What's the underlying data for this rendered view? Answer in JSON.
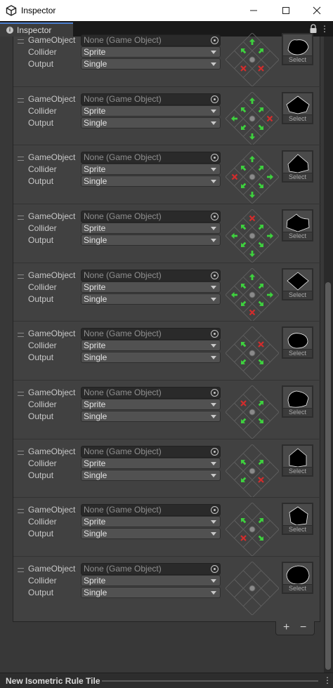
{
  "window": {
    "title": "Inspector",
    "minimize_label": "—",
    "maximize_label": "☐",
    "close_label": "✕"
  },
  "tab": {
    "label": "Inspector",
    "info_icon": "i"
  },
  "labels": {
    "gameobject": "GameObject",
    "collider": "Collider",
    "output": "Output"
  },
  "colors": {
    "arrow": "#3ed13e",
    "blocked": "#d22c2c",
    "panel": "#414141",
    "accent": "#4c7fd0"
  },
  "rules": [
    {
      "gameobject_value": "None (Game Object)",
      "collider": "Sprite",
      "output": "Single",
      "select_label": "Select",
      "neighbors": {
        "n": "arrow",
        "ne": "arrow",
        "e": "none",
        "se": "x",
        "s": "none",
        "sw": "x",
        "w": "none",
        "nw": "arrow"
      }
    },
    {
      "gameobject_value": "None (Game Object)",
      "collider": "Sprite",
      "output": "Single",
      "select_label": "Select",
      "neighbors": {
        "n": "arrow",
        "ne": "arrow",
        "e": "x",
        "se": "arrow",
        "s": "arrow",
        "sw": "arrow",
        "w": "arrow",
        "nw": "arrow"
      }
    },
    {
      "gameobject_value": "None (Game Object)",
      "collider": "Sprite",
      "output": "Single",
      "select_label": "Select",
      "neighbors": {
        "n": "arrow",
        "ne": "arrow",
        "e": "arrow",
        "se": "arrow",
        "s": "arrow",
        "sw": "arrow",
        "w": "x",
        "nw": "arrow"
      }
    },
    {
      "gameobject_value": "None (Game Object)",
      "collider": "Sprite",
      "output": "Single",
      "select_label": "Select",
      "neighbors": {
        "n": "x",
        "ne": "arrow",
        "e": "arrow",
        "se": "arrow",
        "s": "arrow",
        "sw": "arrow",
        "w": "arrow",
        "nw": "arrow"
      }
    },
    {
      "gameobject_value": "None (Game Object)",
      "collider": "Sprite",
      "output": "Single",
      "select_label": "Select",
      "neighbors": {
        "n": "arrow",
        "ne": "arrow",
        "e": "arrow",
        "se": "arrow",
        "s": "x",
        "sw": "arrow",
        "w": "arrow",
        "nw": "arrow"
      }
    },
    {
      "gameobject_value": "None (Game Object)",
      "collider": "Sprite",
      "output": "Single",
      "select_label": "Select",
      "neighbors": {
        "n": "none",
        "ne": "x",
        "e": "none",
        "se": "arrow",
        "s": "none",
        "sw": "arrow",
        "w": "none",
        "nw": "arrow"
      }
    },
    {
      "gameobject_value": "None (Game Object)",
      "collider": "Sprite",
      "output": "Single",
      "select_label": "Select",
      "neighbors": {
        "n": "none",
        "ne": "arrow",
        "e": "none",
        "se": "arrow",
        "s": "none",
        "sw": "arrow",
        "w": "none",
        "nw": "x"
      }
    },
    {
      "gameobject_value": "None (Game Object)",
      "collider": "Sprite",
      "output": "Single",
      "select_label": "Select",
      "neighbors": {
        "n": "none",
        "ne": "arrow",
        "e": "none",
        "se": "x",
        "s": "none",
        "sw": "arrow",
        "w": "none",
        "nw": "arrow"
      }
    },
    {
      "gameobject_value": "None (Game Object)",
      "collider": "Sprite",
      "output": "Single",
      "select_label": "Select",
      "neighbors": {
        "n": "none",
        "ne": "arrow",
        "e": "none",
        "se": "arrow",
        "s": "none",
        "sw": "x",
        "w": "none",
        "nw": "arrow"
      }
    },
    {
      "gameobject_value": "None (Game Object)",
      "collider": "Sprite",
      "output": "Single",
      "select_label": "Select",
      "neighbors": {
        "n": "none",
        "ne": "none",
        "e": "none",
        "se": "none",
        "s": "none",
        "sw": "none",
        "w": "none",
        "nw": "none"
      }
    }
  ],
  "list_controls": {
    "add": "+",
    "remove": "−"
  },
  "footer": {
    "title": "New Isometric Rule Tile",
    "menu": "⋮"
  }
}
